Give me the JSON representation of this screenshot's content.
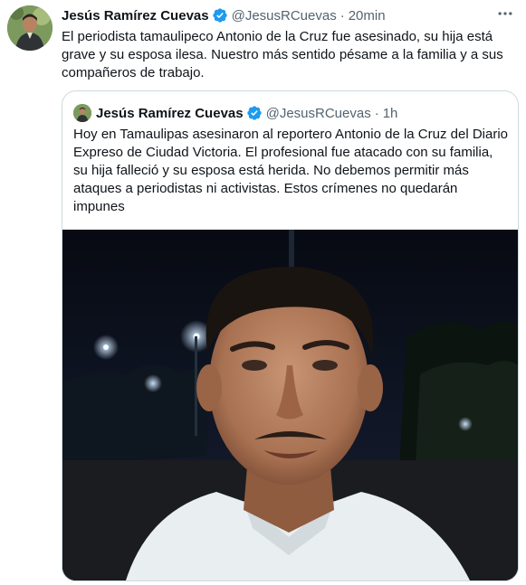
{
  "tweet": {
    "author_name": "Jesús Ramírez Cuevas",
    "handle": "@JesusRCuevas",
    "separator": "·",
    "time": "20min",
    "text": "El periodista tamaulipeco Antonio de la Cruz fue asesinado, su hija está grave y su esposa ilesa. Nuestro más sentido pésame a la familia y a sus compañeros de trabajo.",
    "verified": true,
    "more_icon": "more-icon"
  },
  "quoted": {
    "author_name": "Jesús Ramírez Cuevas",
    "handle": "@JesusRCuevas",
    "separator": "·",
    "time": "1h",
    "text": "Hoy en Tamaulipas asesinaron al reportero Antonio de la Cruz del Diario Expreso de Ciudad Victoria. El profesional fue atacado con su familia, su hija falleció y su esposa está herida. No debemos permitir más ataques a periodistas ni activistas. Estos crímenes no quedarán impunes",
    "verified": true
  },
  "colors": {
    "text_primary": "#0f1419",
    "text_secondary": "#536471",
    "verified_blue": "#1d9bf0",
    "border": "#cfd9de"
  }
}
